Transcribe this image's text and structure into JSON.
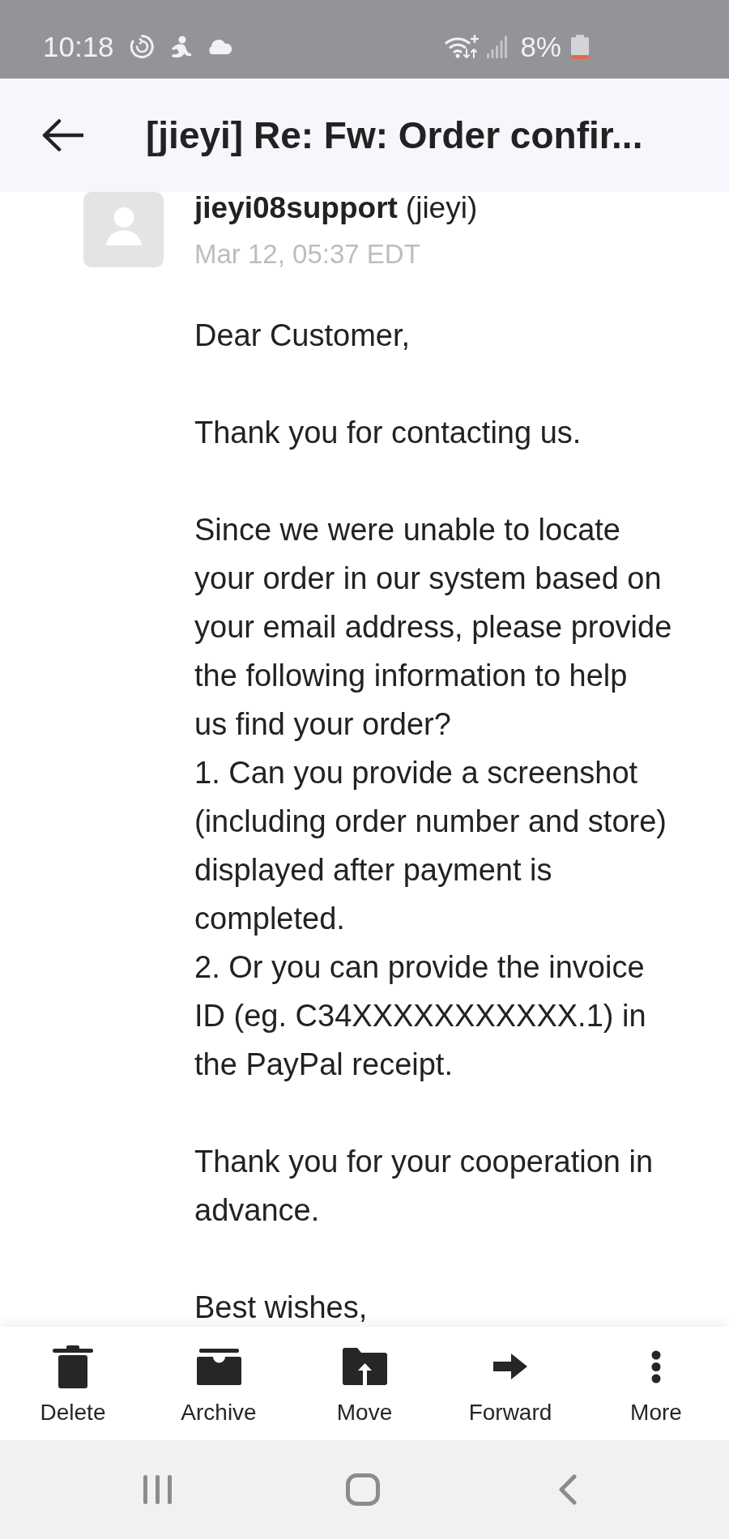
{
  "status_bar": {
    "time": "10:18",
    "battery": "8%"
  },
  "header": {
    "title": "[jieyi] Re: Fw: Order confir..."
  },
  "message": {
    "sender_name": "jieyi08support",
    "sender_alias": "(jieyi)",
    "date": "Mar 12, 05:37 EDT",
    "body": [
      [
        [
          "Dear Customer,"
        ]
      ],
      [
        [
          "Thank you for contacting us."
        ]
      ],
      [
        [
          "Since we were unable to locate",
          "your order in our system based on",
          "your email address, please provide",
          "the following information to help",
          "us find your order?"
        ],
        [
          "1. Can you provide a screenshot",
          "(including order number and store)",
          "displayed after payment is",
          "completed."
        ],
        [
          "2. Or you can provide the invoice",
          "ID (eg. C34XXXXXXXXXXX.1) in",
          "the PayPal receipt."
        ]
      ],
      [
        [
          "Thank you for your cooperation in",
          "advance."
        ]
      ],
      [
        [
          "Best wishes,"
        ]
      ]
    ]
  },
  "actions": [
    {
      "label": "Delete"
    },
    {
      "label": "Archive"
    },
    {
      "label": "Move"
    },
    {
      "label": "Forward"
    },
    {
      "label": "More"
    }
  ]
}
